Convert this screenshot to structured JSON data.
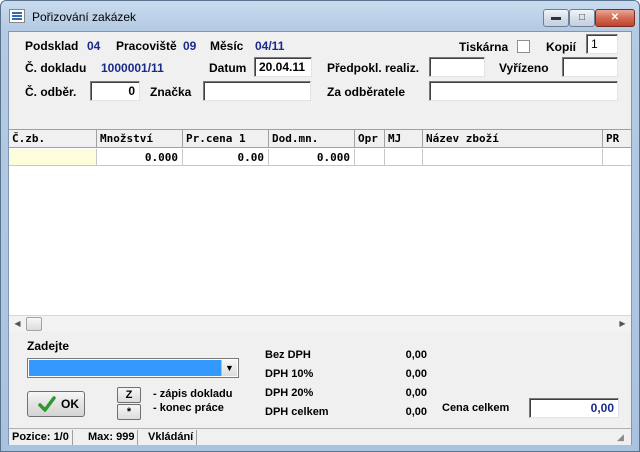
{
  "window": {
    "title": "Pořizování zakázek",
    "minimize": "▬",
    "maximize": "□",
    "close": "✕"
  },
  "header": {
    "podsklad_label": "Podsklad",
    "podsklad_value": "04",
    "pracoviste_label": "Pracoviště",
    "pracoviste_value": "09",
    "mesic_label": "Měsíc",
    "mesic_value": "04/11",
    "tiskarna_label": "Tiskárna",
    "kopii_label": "Kopií",
    "kopii_value": "1",
    "doklad_label": "Č. dokladu",
    "doklad_value": "1000001/11",
    "datum_label": "Datum",
    "datum_value": "20.04.11",
    "predpokl_label": "Předpokl. realiz.",
    "predpokl_value": "",
    "vyrizeno_label": "Vyřízeno",
    "vyrizeno_value": "",
    "odber_label": "Č. odběr.",
    "odber_value": "0",
    "znacka_label": "Značka",
    "znacka_value": "",
    "za_odberatele_label": "Za odběratele",
    "za_odberatele_value": ""
  },
  "grid": {
    "columns": [
      "Č.zb.",
      "Množství",
      "Pr.cena 1",
      "Dod.mn.",
      "Opr",
      "MJ",
      "Název zboží",
      "PR"
    ],
    "rows": [
      [
        "",
        "0.000",
        "0.00",
        "0.000",
        "",
        "",
        "",
        ""
      ]
    ]
  },
  "entry": {
    "zadejte_label": "Zadejte",
    "ok_label": "OK",
    "z_button": "Z",
    "star_button": "*",
    "z_text": "- zápis dokladu",
    "star_text": "- konec práce"
  },
  "totals": {
    "bez_dph_label": "Bez DPH",
    "bez_dph_value": "0,00",
    "dph10_label": "DPH 10%",
    "dph10_value": "0,00",
    "dph20_label": "DPH 20%",
    "dph20_value": "0,00",
    "dph_celkem_label": "DPH celkem",
    "dph_celkem_value": "0,00",
    "cena_celkem_label": "Cena celkem",
    "cena_celkem_value": "0,00"
  },
  "statusbar": {
    "pozice": "Pozice: 1/0",
    "max": "Max: 999",
    "mode": "Vkládání"
  },
  "colors": {
    "label_value_blue": "#1a2a8a",
    "selection_blue": "#3399ff",
    "active_cell": "#fdfddc",
    "ok_check_green": "#2e9a2e"
  }
}
